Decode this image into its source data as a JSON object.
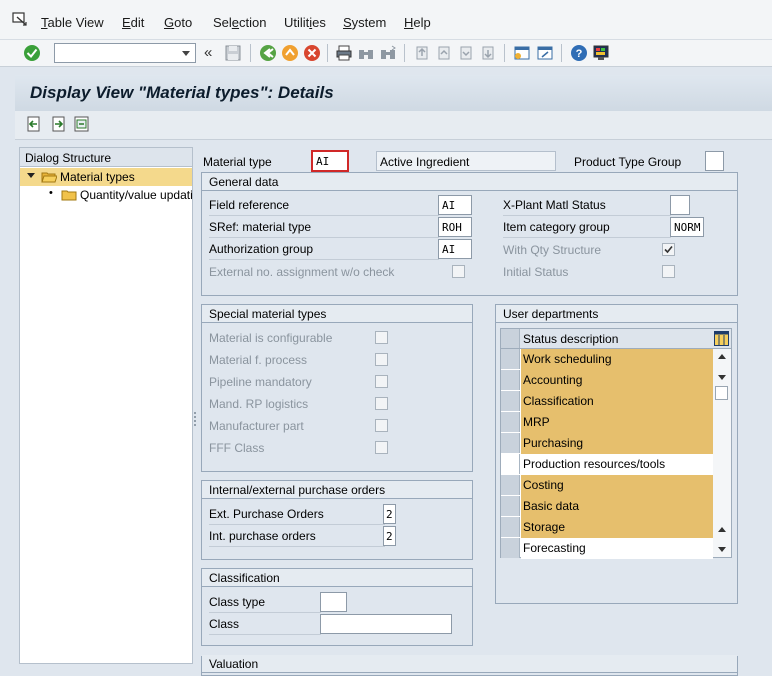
{
  "menu": {
    "items": [
      {
        "underline": "T",
        "rest": "able View"
      },
      {
        "underline": "E",
        "rest": "dit"
      },
      {
        "underline": "G",
        "rest": "oto"
      },
      {
        "underline": "",
        "pre": "Sel",
        "u2": "e",
        "rest": "ction"
      },
      {
        "underline": "",
        "pre": "Utilit",
        "u2": "i",
        "rest": "es"
      },
      {
        "underline": "S",
        "rest": "ystem"
      },
      {
        "underline": "H",
        "rest": "elp"
      }
    ],
    "labels": [
      "Table View",
      "Edit",
      "Goto",
      "Selection",
      "Utilities",
      "System",
      "Help"
    ]
  },
  "toolbar": {
    "command_field_value": "",
    "history_glyph": "«"
  },
  "title": "Display View \"Material types\": Details",
  "tree": {
    "header": "Dialog Structure",
    "items": [
      {
        "label": "Material types",
        "selected": true,
        "expanded": true
      },
      {
        "label": "Quantity/value updating",
        "selected": false
      }
    ]
  },
  "header_fields": {
    "material_type_label": "Material type",
    "material_type_value": "AI",
    "material_type_desc": "Active Ingredient",
    "product_type_group_label": "Product Type Group",
    "product_type_group_value": ""
  },
  "general_data": {
    "title": "General data",
    "field_reference_label": "Field reference",
    "field_reference_value": "AI",
    "sref_label": "SRef: material type",
    "sref_value": "ROH",
    "auth_group_label": "Authorization group",
    "auth_group_value": "AI",
    "ext_no_label": "External no. assignment w/o check",
    "xplant_label": "X-Plant Matl Status",
    "xplant_value": "",
    "item_cat_label": "Item category group",
    "item_cat_value": "NORM",
    "with_qty_label": "With Qty Structure",
    "with_qty_checked": true,
    "initial_status_label": "Initial Status"
  },
  "special_material": {
    "title": "Special material types",
    "items": [
      "Material is configurable",
      "Material f. process",
      "Pipeline mandatory",
      "Mand. RP logistics",
      "Manufacturer part",
      "FFF Class"
    ]
  },
  "purchase_orders": {
    "title": "Internal/external purchase orders",
    "ext_label": "Ext. Purchase Orders",
    "ext_value": "2",
    "int_label": "Int. purchase orders",
    "int_value": "2"
  },
  "classification": {
    "title": "Classification",
    "class_type_label": "Class type",
    "class_type_value": "",
    "class_label": "Class",
    "class_value": ""
  },
  "user_departments": {
    "title": "User departments",
    "column_header": "Status description",
    "rows": [
      {
        "label": "Work scheduling",
        "selected": true
      },
      {
        "label": "Accounting",
        "selected": true
      },
      {
        "label": "Classification",
        "selected": true
      },
      {
        "label": "MRP",
        "selected": true
      },
      {
        "label": "Purchasing",
        "selected": true
      },
      {
        "label": "Production resources/tools",
        "selected": false
      },
      {
        "label": "Costing",
        "selected": true
      },
      {
        "label": "Basic data",
        "selected": true
      },
      {
        "label": "Storage",
        "selected": true
      },
      {
        "label": "Forecasting",
        "selected": false
      }
    ]
  },
  "valuation": {
    "title": "Valuation"
  },
  "colors": {
    "highlight": "#e6bf6d",
    "background": "#dfe6ee",
    "title_text": "#0c1c2c"
  }
}
